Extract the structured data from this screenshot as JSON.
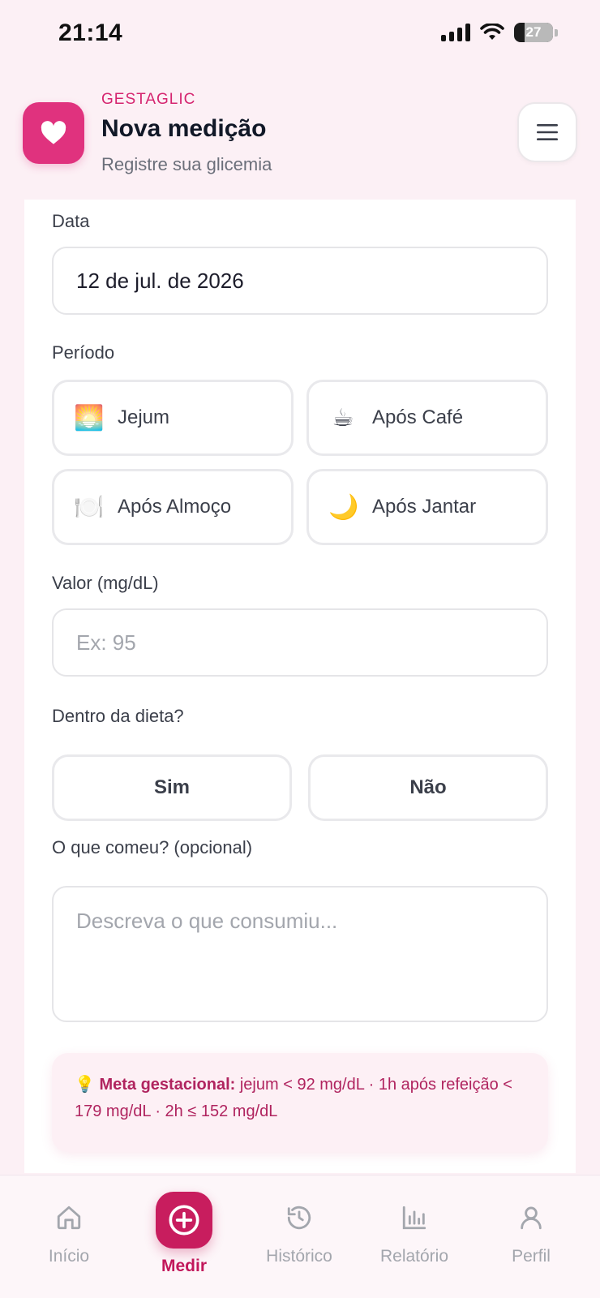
{
  "status_bar": {
    "time": "21:14",
    "battery": "27"
  },
  "header": {
    "app_name": "GESTAGLIC",
    "title": "Nova medição",
    "subtitle": "Registre sua glicemia"
  },
  "form": {
    "date": {
      "label": "Data",
      "value": "12 de jul. de 2026"
    },
    "period": {
      "label": "Período",
      "options": [
        {
          "emoji": "🌅",
          "label": "Jejum"
        },
        {
          "emoji": "☕",
          "label": "Após Café"
        },
        {
          "emoji": "🍽️",
          "label": "Após Almoço"
        },
        {
          "emoji": "🌙",
          "label": "Após Jantar"
        }
      ]
    },
    "value": {
      "label": "Valor (mg/dL)",
      "placeholder": "Ex: 95"
    },
    "diet": {
      "label": "Dentro da dieta?",
      "yes": "Sim",
      "no": "Não"
    },
    "food": {
      "label": "O que comeu? (opcional)",
      "placeholder": "Descreva o que consumiu..."
    },
    "tip": {
      "icon": "💡",
      "title": "Meta gestacional:",
      "text": "jejum < 92 mg/dL · 1h após refeição < 179 mg/dL · 2h ≤ 152 mg/dL"
    }
  },
  "nav": {
    "items": [
      {
        "label": "Início",
        "icon": "home-icon"
      },
      {
        "label": "Medir",
        "icon": "plus-circle-icon",
        "active": true
      },
      {
        "label": "Histórico",
        "icon": "history-icon"
      },
      {
        "label": "Relatório",
        "icon": "bar-chart-icon"
      },
      {
        "label": "Perfil",
        "icon": "user-icon"
      }
    ]
  },
  "colors": {
    "accent": "#e0327e",
    "accent_dark": "#c81d5e",
    "background": "#fcf0f5"
  }
}
